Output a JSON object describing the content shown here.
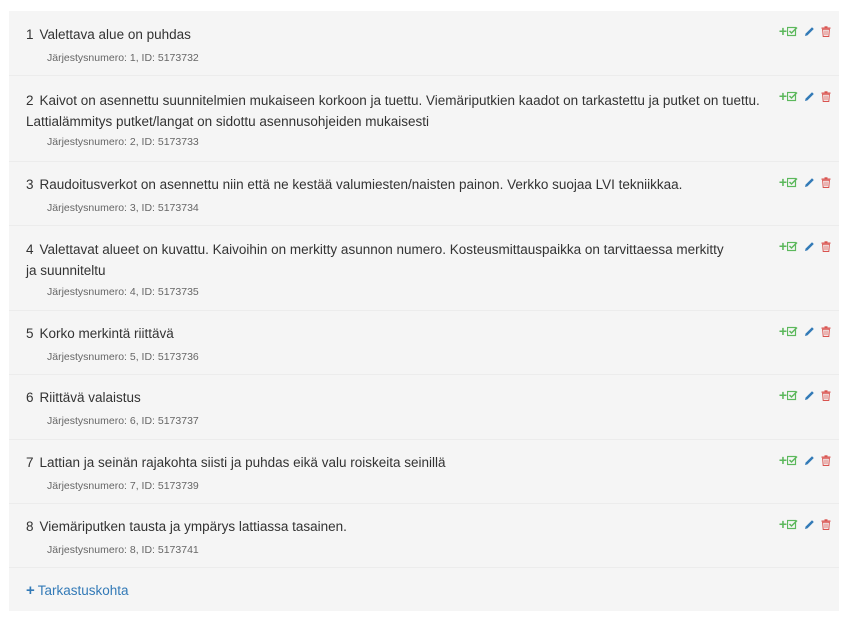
{
  "items": [
    {
      "num": "1",
      "text": "Valettava alue on puhdas",
      "meta": "Järjestysnumero: 1, ID: 5173732"
    },
    {
      "num": "2",
      "text": "Kaivot on asennettu suunnitelmien mukaiseen korkoon ja tuettu. Viemäriputkien kaadot on tarkastettu ja putket on tuettu. Lattialämmitys putket/langat on sidottu asennusohjeiden mukaisesti",
      "meta": "Järjestysnumero: 2, ID: 5173733"
    },
    {
      "num": "3",
      "text": "Raudoitusverkot on asennettu niin että ne kestää valumiesten/naisten painon. Verkko suojaa LVI tekniikkaa.",
      "meta": "Järjestysnumero: 3, ID: 5173734"
    },
    {
      "num": "4",
      "text": "Valettavat alueet on kuvattu. Kaivoihin on merkitty asunnon numero. Kosteusmittauspaikka on tarvittaessa merkitty ja suunniteltu",
      "meta": "Järjestysnumero: 4, ID: 5173735"
    },
    {
      "num": "5",
      "text": "Korko merkintä riittävä",
      "meta": "Järjestysnumero: 5, ID: 5173736"
    },
    {
      "num": "6",
      "text": "Riittävä valaistus",
      "meta": "Järjestysnumero: 6, ID: 5173737"
    },
    {
      "num": "7",
      "text": "Lattian ja seinän rajakohta siisti ja puhdas eikä valu roiskeita seinillä",
      "meta": "Järjestysnumero: 7, ID: 5173739"
    },
    {
      "num": "8",
      "text": "Viemäriputken tausta ja ympärys lattiassa tasainen.",
      "meta": "Järjestysnumero: 8, ID: 5173741"
    }
  ],
  "actions": {
    "add_icon": "plus-icon",
    "check_icon": "checkbox-icon",
    "edit_icon": "pencil-icon",
    "delete_icon": "trash-icon"
  },
  "add_item": {
    "label": "Tarkastuskohta",
    "icon": "plus-icon"
  },
  "colors": {
    "green": "#5cb85c",
    "blue": "#337ab7",
    "red": "#d9534f"
  }
}
